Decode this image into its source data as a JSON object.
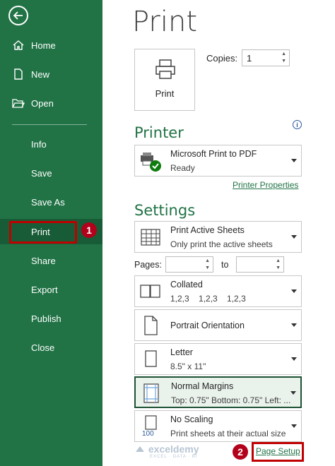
{
  "sidebar": {
    "items": [
      {
        "label": "Home",
        "icon": "home-icon"
      },
      {
        "label": "New",
        "icon": "new-document-icon"
      },
      {
        "label": "Open",
        "icon": "folder-icon"
      },
      {
        "label": "Info"
      },
      {
        "label": "Save"
      },
      {
        "label": "Save As"
      },
      {
        "label": "Print"
      },
      {
        "label": "Share"
      },
      {
        "label": "Export"
      },
      {
        "label": "Publish"
      },
      {
        "label": "Close"
      }
    ],
    "bg_color": "#217346"
  },
  "main": {
    "title": "Print",
    "print_button": "Print",
    "copies_label": "Copies:",
    "copies_value": "1",
    "printer": {
      "heading": "Printer",
      "name": "Microsoft Print to PDF",
      "status": "Ready",
      "properties_link": "Printer Properties"
    },
    "settings": {
      "heading": "Settings",
      "what_title": "Print Active Sheets",
      "what_desc": "Only print the active sheets",
      "pages_label": "Pages:",
      "to_label": "to",
      "collate_title": "Collated",
      "collate_desc": "1,2,3    1,2,3    1,2,3",
      "orientation": "Portrait Orientation",
      "paper_title": "Letter",
      "paper_desc": "8.5\" x 11\"",
      "margins_title": "Normal Margins",
      "margins_desc": "Top: 0.75\" Bottom: 0.75\" Left: ...",
      "scaling_title": "No Scaling",
      "scaling_desc": "Print sheets at their actual size",
      "scaling_badge": "100",
      "page_setup_link": "Page Setup"
    }
  },
  "annotations": {
    "badge1": "1",
    "badge2": "2",
    "highlight_color": "#c00000"
  },
  "watermark": {
    "name": "exceldemy",
    "tagline": "EXCEL · DATA · BI"
  }
}
